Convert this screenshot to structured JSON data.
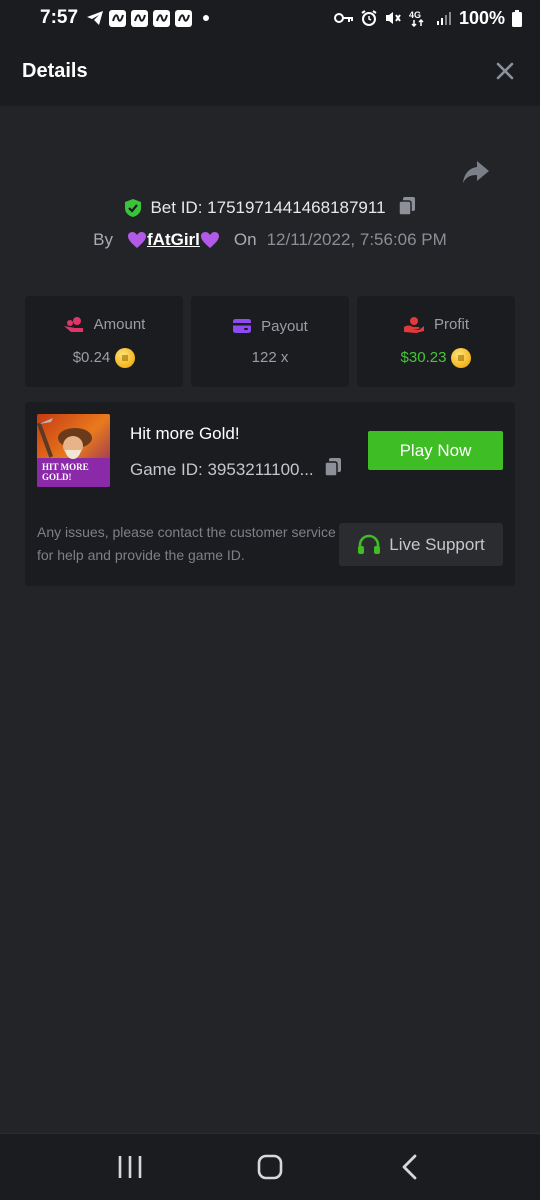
{
  "status_bar": {
    "time": "7:57",
    "battery": "100%",
    "network": "4G"
  },
  "header": {
    "title": "Details"
  },
  "bet": {
    "label": "Bet ID: 1751971441468187911",
    "by_label": "By",
    "username": "fAtGirl",
    "on_label": "On",
    "datetime": "12/11/2022, 7:56:06 PM"
  },
  "stats": {
    "amount_label": "Amount",
    "amount_value": "$0.24",
    "payout_label": "Payout",
    "payout_value": "122 x",
    "profit_label": "Profit",
    "profit_value": "$30.23"
  },
  "game": {
    "title": "Hit more Gold!",
    "id_text": "Game ID: 3953211100...",
    "thumb_text_line1": "HIT MORE",
    "thumb_text_line2": "GOLD!",
    "play_label": "Play Now"
  },
  "support": {
    "message": "Any issues, please contact the customer service for help and provide the game ID.",
    "button_label": "Live Support"
  },
  "colors": {
    "background": "#232427",
    "panel": "#1b1c1f",
    "accent_green": "#3fbd25",
    "profit_green": "#48c53a",
    "amount_icon": "#e0356a",
    "payout_icon": "#8c4cf0",
    "profit_icon": "#e23a3a"
  },
  "icons": {
    "close": "close-icon",
    "share": "share-icon",
    "shield": "shield-check-icon",
    "copy": "copy-icon",
    "headset": "headset-icon",
    "coin": "coin-icon"
  }
}
